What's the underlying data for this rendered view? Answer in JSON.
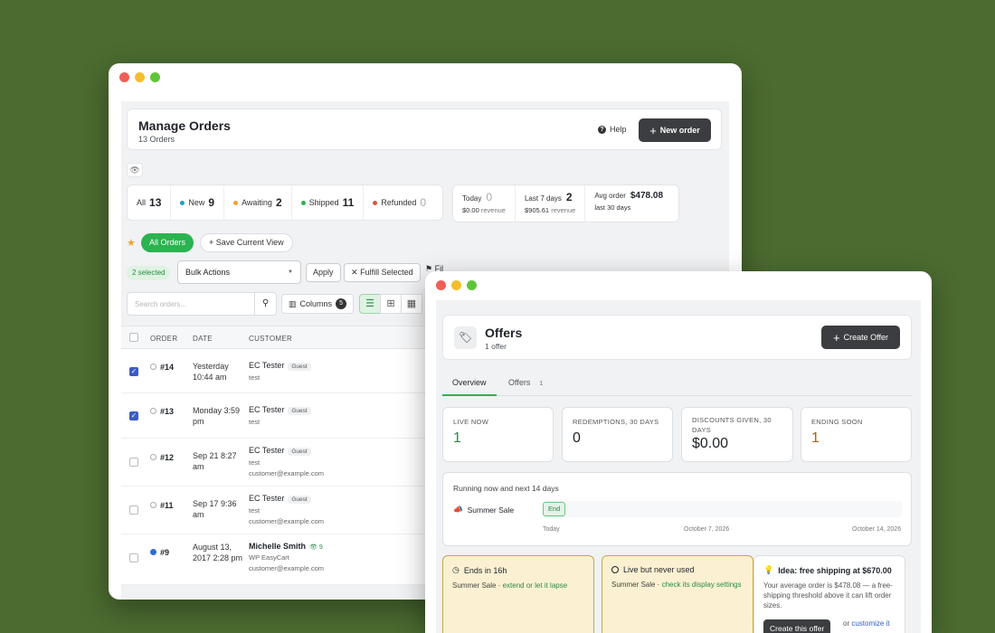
{
  "orders_window": {
    "title": "Manage Orders",
    "subtitle": "13 Orders",
    "help_label": "Help",
    "new_order_label": "New order",
    "status_counts": [
      {
        "label": "All",
        "count": "13",
        "color": ""
      },
      {
        "label": "New",
        "count": "9",
        "color": "#1aa0c9"
      },
      {
        "label": "Awaiting",
        "count": "2",
        "color": "#f0a32a"
      },
      {
        "label": "Shipped",
        "count": "11",
        "color": "#2bb34f"
      },
      {
        "label": "Refunded",
        "count": "0",
        "color": "#e0523f"
      }
    ],
    "revenue": [
      {
        "label": "Today",
        "value": "0",
        "amount": "$0.00",
        "note": "revenue"
      },
      {
        "label": "Last 7 days",
        "value": "2",
        "amount": "$905.61",
        "note": "revenue"
      },
      {
        "label": "Avg order",
        "value": "$478.08",
        "amount": "last 30 days",
        "note": ""
      }
    ],
    "views": {
      "all_orders": "All Orders",
      "save_view": "Save Current View"
    },
    "bulk": {
      "selected": "2 selected",
      "actions": "Bulk Actions",
      "apply": "Apply",
      "fulfill": "Fulfill Selected",
      "filter_partial": "Fil"
    },
    "search": {
      "placeholder": "Search orders..."
    },
    "columns": {
      "label": "Columns",
      "count": "5"
    },
    "table": {
      "headers": {
        "order": "ORDER",
        "date": "DATE",
        "customer": "CUSTOMER"
      },
      "rows": [
        {
          "checked": true,
          "status": "open",
          "order": "#14",
          "date": "Yesterday 10:44 am",
          "name": "EC Tester",
          "badge": "Guest",
          "line2": "test",
          "line3": ""
        },
        {
          "checked": true,
          "status": "open",
          "order": "#13",
          "date": "Monday 3:59 pm",
          "name": "EC Tester",
          "badge": "Guest",
          "line2": "test",
          "line3": ""
        },
        {
          "checked": false,
          "status": "open",
          "order": "#12",
          "date": "Sep 21 8:27 am",
          "name": "EC Tester",
          "badge": "Guest",
          "line2": "test",
          "line3": "customer@example.com"
        },
        {
          "checked": false,
          "status": "open",
          "order": "#11",
          "date": "Sep 17 9:36 am",
          "name": "EC Tester",
          "badge": "Guest",
          "line2": "test",
          "line3": "customer@example.com"
        },
        {
          "checked": false,
          "status": "blue",
          "order": "#9",
          "date": "August 13, 2017 2:28 pm",
          "name": "Michelle Smith",
          "badge": "9",
          "line2": "WP EasyCart",
          "line3": "customer@example.com"
        }
      ]
    }
  },
  "offers_window": {
    "title": "Offers",
    "subtitle": "1 offer",
    "create_label": "Create Offer",
    "tabs": [
      {
        "label": "Overview",
        "count": ""
      },
      {
        "label": "Offers",
        "count": "1"
      }
    ],
    "stats": [
      {
        "label": "LIVE NOW",
        "value": "1"
      },
      {
        "label": "REDEMPTIONS, 30 DAYS",
        "value": "0"
      },
      {
        "label": "DISCOUNTS GIVEN, 30 DAYS",
        "value": "$0.00"
      },
      {
        "label": "ENDING SOON",
        "value": "1"
      }
    ],
    "timeline": {
      "title": "Running now and next 14 days",
      "row_label": "Summer Sale",
      "bar_label": "End",
      "ticks": [
        "Today",
        "October 7, 2026",
        "October 14, 2026"
      ]
    },
    "alerts": [
      {
        "title": "Ends in 16h",
        "prefix": "Summer Sale · ",
        "link": "extend or let it lapse"
      },
      {
        "title": "Live but never used",
        "prefix": "Summer Sale · ",
        "link": "check its display settings"
      }
    ],
    "idea": {
      "title": "Idea: free shipping at $670.00",
      "body": "Your average order is $478.08 — a free-shipping threshold above it can lift order sizes.",
      "button": "Create this offer",
      "alt_prefix": "or ",
      "alt_link": "customize it"
    }
  }
}
